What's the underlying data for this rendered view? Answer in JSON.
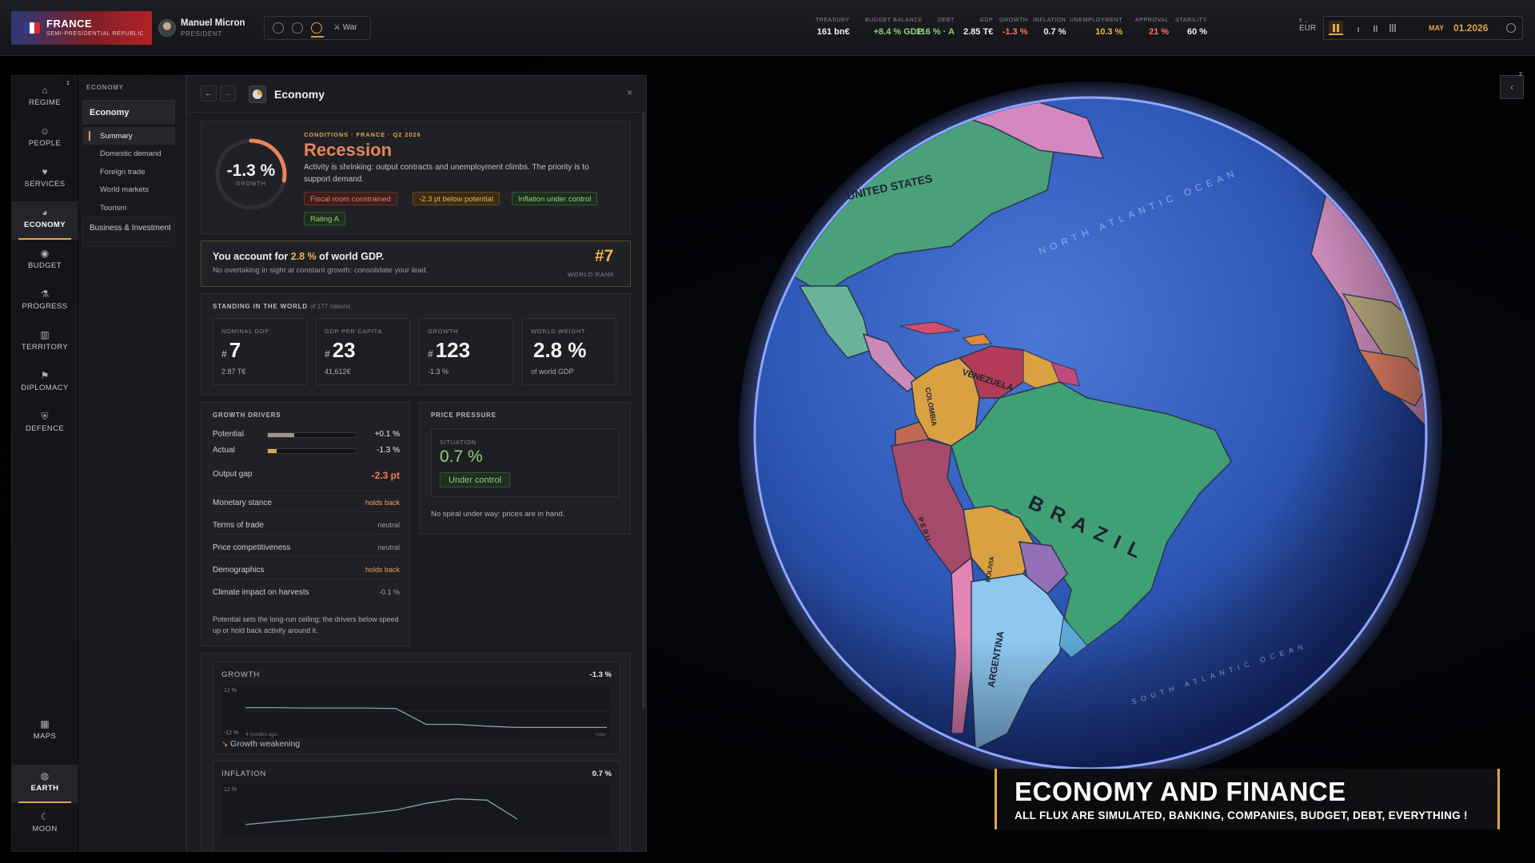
{
  "country": {
    "name": "FRANCE",
    "regime": "SEMI-PRESIDENTIAL REPUBLIC",
    "flag_colors": [
      "#2b3f9c",
      "#ffffff",
      "#d62a32"
    ]
  },
  "leader": {
    "name": "Manuel Micron",
    "role": "PRESIDENT"
  },
  "modes": {
    "war_label": "War"
  },
  "stats": [
    {
      "label": "TREASURY",
      "value": "161 bn€",
      "color": "#f0f0f0"
    },
    {
      "label": "BUDGET BALANCE",
      "value": "+8.4 % GDP",
      "color": "#8fd07a"
    },
    {
      "label": "DEBT",
      "value": "116 % · A",
      "color": "#8fd07a"
    },
    {
      "label": "GDP",
      "value": "2.85 T€",
      "color": "#f0f0f0"
    },
    {
      "label": "GROWTH",
      "value": "-1.3 %",
      "color": "#f27a62"
    },
    {
      "label": "INFLATION",
      "value": "0.7 %",
      "color": "#f0f0f0"
    },
    {
      "label": "UNEMPLOYMENT",
      "value": "10.3 %",
      "color": "#f0b24f"
    },
    {
      "label": "APPROVAL",
      "value": "21 %",
      "color": "#f27a62"
    },
    {
      "label": "STABILITY",
      "value": "60 %",
      "color": "#f0f0f0"
    }
  ],
  "currency": {
    "label": "€",
    "code": "EUR"
  },
  "date": {
    "month": "MAY",
    "day_year": "01.2026"
  },
  "rail": {
    "badge": "1",
    "items": [
      {
        "label": "REGIME",
        "icon": "⌂"
      },
      {
        "label": "PEOPLE",
        "icon": "☺"
      },
      {
        "label": "SERVICES",
        "icon": "♥"
      },
      {
        "label": "ECONOMY",
        "icon": "◕"
      },
      {
        "label": "BUDGET",
        "icon": "◉"
      },
      {
        "label": "PROGRESS",
        "icon": "⚗"
      },
      {
        "label": "TERRITORY",
        "icon": "▥"
      },
      {
        "label": "DIPLOMACY",
        "icon": "⚑"
      },
      {
        "label": "DEFENCE",
        "icon": "⛨"
      }
    ],
    "bottom": [
      {
        "label": "MAPS",
        "icon": "▦"
      },
      {
        "label": "EARTH",
        "icon": "◍"
      },
      {
        "label": "MOON",
        "icon": "☾"
      }
    ]
  },
  "subnav": {
    "header": "ECONOMY",
    "group": "Economy",
    "items": [
      "Summary",
      "Domestic demand",
      "Foreign trade",
      "World markets",
      "Tourism"
    ],
    "business": "Business & Investment"
  },
  "panel": {
    "title": "Economy",
    "back": "←",
    "forward": "→",
    "close": "×"
  },
  "hero": {
    "gauge_value": "-1.3 %",
    "gauge_label": "GROWTH",
    "gauge_fraction": 0.28,
    "kicker": "CONDITIONS · FRANCE · Q2 2026",
    "title": "Recession",
    "description": "Activity is shrinking: output contracts and unemployment climbs. The priority is to support demand.",
    "tags": [
      {
        "text": "Fiscal room constrained",
        "kind": "red"
      },
      {
        "text": "-2.3 pt below potential",
        "kind": "amber"
      },
      {
        "text": "Inflation under control",
        "kind": "green"
      },
      {
        "text": "Rating A",
        "kind": "green"
      }
    ]
  },
  "rank": {
    "title_prefix": "You account for",
    "share": "2.8 %",
    "title_suffix": "of world GDP.",
    "subtitle": "No overtaking in sight at constant growth: consolidate your lead.",
    "number": "#7",
    "label": "WORLD RANK"
  },
  "standing": {
    "title": "STANDING IN THE WORLD",
    "subtitle": "of 177 nations",
    "boxes": [
      {
        "label": "NOMINAL GDP",
        "hash": "#",
        "value": "7",
        "sub": "2.87 T€"
      },
      {
        "label": "GDP PER CAPITA",
        "hash": "#",
        "value": "23",
        "sub": "41,612€"
      },
      {
        "label": "GROWTH",
        "hash": "#",
        "value": "123",
        "sub": "-1.3 %"
      },
      {
        "label": "WORLD WEIGHT",
        "hash": "",
        "value": "2.8 %",
        "sub": "of world GDP"
      }
    ]
  },
  "drivers": {
    "title": "GROWTH DRIVERS",
    "bars": [
      {
        "label": "Potential",
        "value": "+0.1 %",
        "fill": 0.3,
        "color": "#9c958a"
      },
      {
        "label": "Actual",
        "value": "-1.3 %",
        "fill": 0.1,
        "color": "#e0a54c"
      }
    ],
    "output_gap_label": "Output gap",
    "output_gap_value": "-2.3 pt",
    "rows": [
      {
        "label": "Monetary stance",
        "value": "holds back",
        "kind": "neg"
      },
      {
        "label": "Terms of trade",
        "value": "neutral",
        "kind": "neu"
      },
      {
        "label": "Price competitiveness",
        "value": "neutral",
        "kind": "neu"
      },
      {
        "label": "Demographics",
        "value": "holds back",
        "kind": "neg"
      },
      {
        "label": "Climate impact on harvests",
        "value": "-0.1 %",
        "kind": "neu"
      }
    ],
    "note": "Potential sets the long-run ceiling; the drivers below speed up or hold back activity around it."
  },
  "price": {
    "title": "PRICE PRESSURE",
    "situation_label": "SITUATION",
    "value": "0.7 %",
    "status": "Under control",
    "note": "No spiral under way: prices are in hand."
  },
  "charts": {
    "growth": {
      "title": "GROWTH",
      "value": "-1.3 %",
      "ytop": "12 %",
      "ybottom": "-12 %",
      "xstart": "4 months ago",
      "xend": "now",
      "trend": "Growth weakening"
    },
    "inflation": {
      "title": "INFLATION",
      "value": "0.7 %",
      "ytop": "12 %"
    }
  },
  "chart_data": [
    {
      "type": "line",
      "title": "GROWTH",
      "ylim": [
        -12,
        12
      ],
      "x_labels": [
        "4 months ago",
        "now"
      ],
      "series": [
        {
          "values": [
            1.6,
            1.6,
            1.4,
            1.4,
            1.4,
            1.2,
            -6.0,
            -6.0,
            -6.8,
            -7.4,
            -7.4,
            -7.4,
            -7.4
          ]
        }
      ]
    },
    {
      "type": "line",
      "title": "INFLATION",
      "ylim": [
        -12,
        12
      ],
      "series": [
        {
          "values": [
            -6.5,
            -5.2,
            -4.0,
            -2.8,
            -1.5,
            0.2,
            3.2,
            5.2,
            4.6,
            -4.0
          ]
        }
      ]
    }
  ],
  "map": {
    "labels": [
      "UNITED STATES",
      "VENEZUELA",
      "COLOMBIA",
      "BRAZIL",
      "PERU",
      "BOLIVIA",
      "ARGENTINA"
    ],
    "oceans": [
      "NORTH ATLANTIC OCEAN",
      "SOUTH ATLANTIC OCEAN"
    ]
  },
  "right_toggle": {
    "icon": "‹",
    "badge": "2"
  },
  "banner": {
    "title": "ECONOMY AND FINANCE",
    "subtitle": "ALL FLUX ARE SIMULATED, BANKING, COMPANIES, BUDGET, DEBT, EVERYTHING !"
  }
}
